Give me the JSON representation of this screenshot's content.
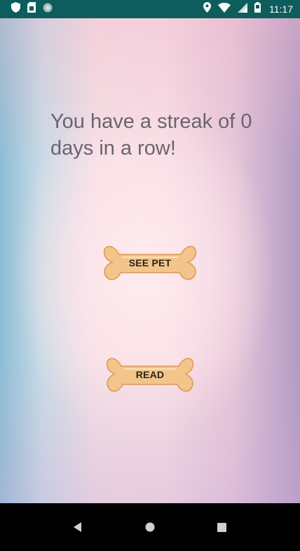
{
  "status_bar": {
    "time": "11:17",
    "icons": [
      "shield-icon",
      "sim-card-icon",
      "circle-notification-icon",
      "location-icon",
      "wifi-icon",
      "signal-icon",
      "battery-icon"
    ]
  },
  "main": {
    "streak_message": "You have a streak of 0 days in a row!",
    "buttons": {
      "see_pet": "SEE PET",
      "read": "READ"
    }
  },
  "nav_bar": {
    "icons": [
      "back-icon",
      "home-icon",
      "recents-icon"
    ]
  },
  "colors": {
    "status_bar": "#0c5d5c",
    "bone_fill": "#f3c58a",
    "bone_stroke": "#d99a55",
    "text": "#6a6470"
  }
}
